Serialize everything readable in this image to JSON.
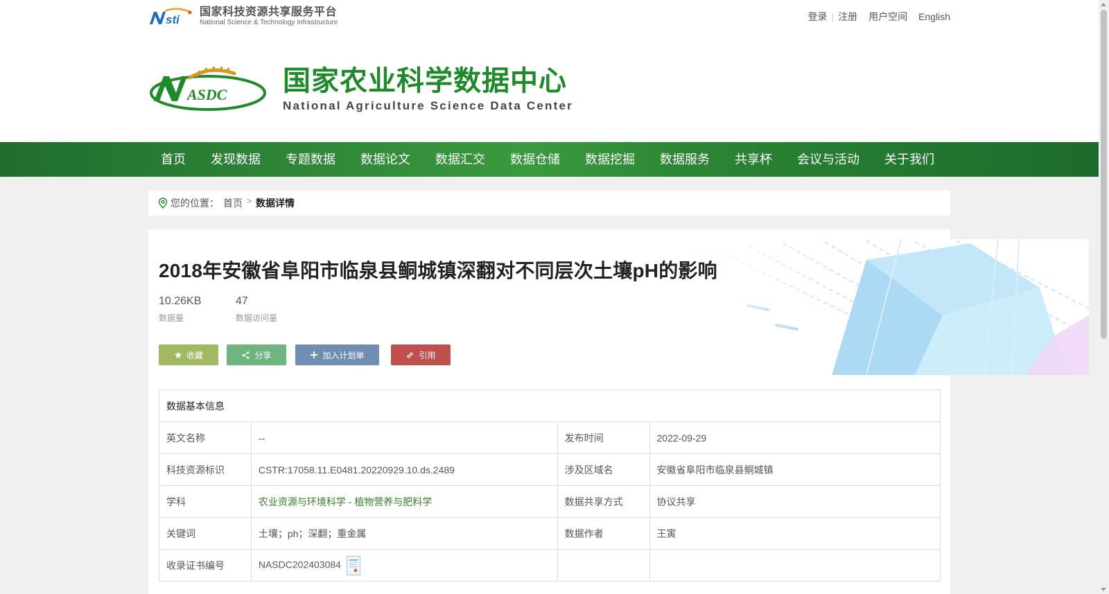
{
  "header": {
    "nsti_cn": "国家科技资源共享服务平台",
    "nsti_en": "National Science & Technology Infrastructure",
    "links": {
      "login": "登录",
      "register": "注册",
      "user_space": "用户空间",
      "english": "English"
    },
    "brand_cn": "国家农业科学数据中心",
    "brand_en": "National Agriculture Science Data Center"
  },
  "nav": [
    "首页",
    "发现数据",
    "专题数据",
    "数据论文",
    "数据汇交",
    "数据仓储",
    "数据挖掘",
    "数据服务",
    "共享杯",
    "会议与活动",
    "关于我们"
  ],
  "breadcrumb": {
    "label": "您的位置：",
    "home": "首页",
    "current": "数据详情"
  },
  "dataset": {
    "title": "2018年安徽省阜阳市临泉县鲖城镇深翻对不同层次土壤pH的影响",
    "size_value": "10.26KB",
    "size_label": "数据量",
    "visits_value": "47",
    "visits_label": "数据访问量"
  },
  "buttons": {
    "favorite": "收藏",
    "share": "分享",
    "plan": "加入计划单",
    "cite": "引用"
  },
  "info": {
    "heading": "数据基本信息",
    "english_name_label": "英文名称",
    "english_name": "--",
    "publish_label": "发布时间",
    "publish": "2022-09-29",
    "cstr_label": "科技资源标识",
    "cstr": "CSTR:17058.11.E0481.20220929.10.ds.2489",
    "region_label": "涉及区域名",
    "region": "安徽省阜阳市临泉县鲖城镇",
    "subject_label": "学科",
    "subject_main": "农业资源与环境科学",
    "subject_sep": " - ",
    "subject_sub": "植物营养与肥料学",
    "share_label": "数据共享方式",
    "share": "协议共享",
    "keywords_label": "关键词",
    "keywords": "土壤；ph；深翻；重金属",
    "author_label": "数据作者",
    "author": "王寅",
    "cert_label": "收录证书编号",
    "cert": "NASDC202403084"
  },
  "colors": {
    "nav_green": "#2b8634",
    "brand_green": "#1e8a2a",
    "btn_favorite": "#a1b961",
    "btn_share": "#6fb57f",
    "btn_plan": "#6f8fb2",
    "btn_cite": "#c0504d"
  }
}
